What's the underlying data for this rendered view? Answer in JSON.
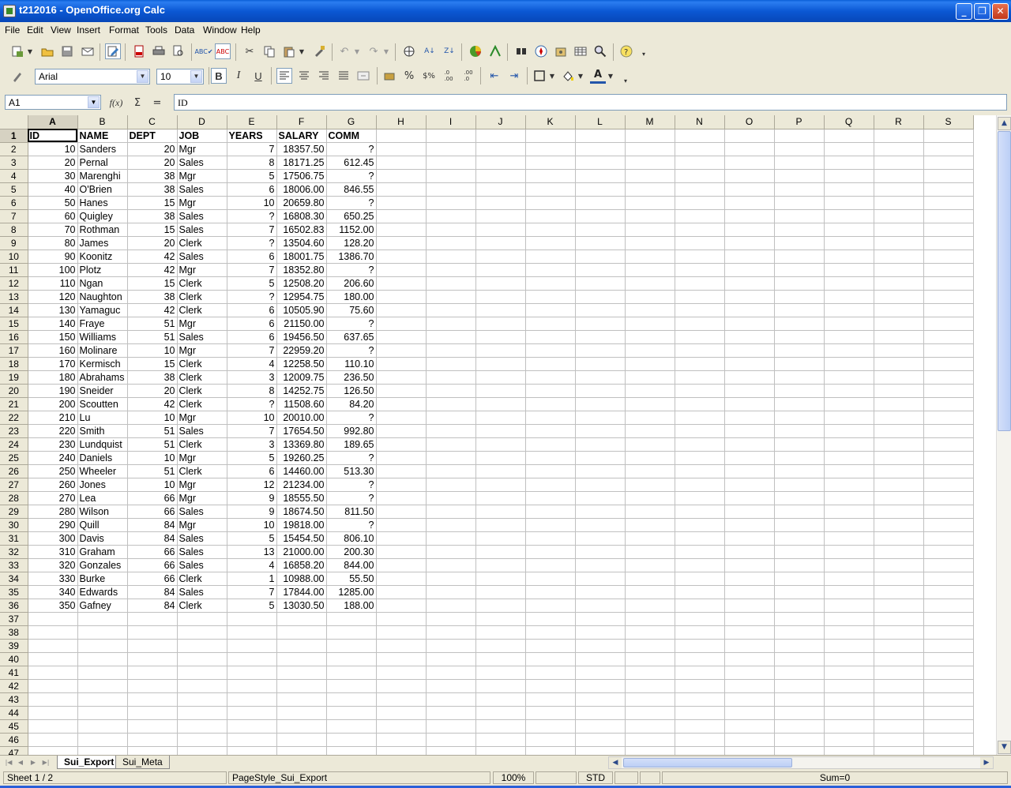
{
  "window": {
    "title": "t212016 - OpenOffice.org Calc"
  },
  "menu": [
    "File",
    "Edit",
    "View",
    "Insert",
    "Format",
    "Tools",
    "Data",
    "Window",
    "Help"
  ],
  "format_toolbar": {
    "font_name": "Arial",
    "font_size": "10"
  },
  "formula_bar": {
    "cell_ref": "A1",
    "content": "ID",
    "function_wizard": "f(x)",
    "sum": "Σ",
    "equals": "="
  },
  "columns": [
    "A",
    "B",
    "C",
    "D",
    "E",
    "F",
    "G",
    "H",
    "I",
    "J",
    "K",
    "L",
    "M",
    "N",
    "O",
    "P",
    "Q",
    "R",
    "S"
  ],
  "headers": [
    "ID",
    "NAME",
    "DEPT",
    "JOB",
    "YEARS",
    "SALARY",
    "COMM"
  ],
  "rows": [
    [
      "10",
      "Sanders",
      "20",
      "Mgr",
      "7",
      "18357.50",
      "?"
    ],
    [
      "20",
      "Pernal",
      "20",
      "Sales",
      "8",
      "18171.25",
      "612.45"
    ],
    [
      "30",
      "Marenghi",
      "38",
      "Mgr",
      "5",
      "17506.75",
      "?"
    ],
    [
      "40",
      "O'Brien",
      "38",
      "Sales",
      "6",
      "18006.00",
      "846.55"
    ],
    [
      "50",
      "Hanes",
      "15",
      "Mgr",
      "10",
      "20659.80",
      "?"
    ],
    [
      "60",
      "Quigley",
      "38",
      "Sales",
      "?",
      "16808.30",
      "650.25"
    ],
    [
      "70",
      "Rothman",
      "15",
      "Sales",
      "7",
      "16502.83",
      "1152.00"
    ],
    [
      "80",
      "James",
      "20",
      "Clerk",
      "?",
      "13504.60",
      "128.20"
    ],
    [
      "90",
      "Koonitz",
      "42",
      "Sales",
      "6",
      "18001.75",
      "1386.70"
    ],
    [
      "100",
      "Plotz",
      "42",
      "Mgr",
      "7",
      "18352.80",
      "?"
    ],
    [
      "110",
      "Ngan",
      "15",
      "Clerk",
      "5",
      "12508.20",
      "206.60"
    ],
    [
      "120",
      "Naughton",
      "38",
      "Clerk",
      "?",
      "12954.75",
      "180.00"
    ],
    [
      "130",
      "Yamaguc",
      "42",
      "Clerk",
      "6",
      "10505.90",
      "75.60"
    ],
    [
      "140",
      "Fraye",
      "51",
      "Mgr",
      "6",
      "21150.00",
      "?"
    ],
    [
      "150",
      "Williams",
      "51",
      "Sales",
      "6",
      "19456.50",
      "637.65"
    ],
    [
      "160",
      "Molinare",
      "10",
      "Mgr",
      "7",
      "22959.20",
      "?"
    ],
    [
      "170",
      "Kermisch",
      "15",
      "Clerk",
      "4",
      "12258.50",
      "110.10"
    ],
    [
      "180",
      "Abrahams",
      "38",
      "Clerk",
      "3",
      "12009.75",
      "236.50"
    ],
    [
      "190",
      "Sneider",
      "20",
      "Clerk",
      "8",
      "14252.75",
      "126.50"
    ],
    [
      "200",
      "Scoutten",
      "42",
      "Clerk",
      "?",
      "11508.60",
      "84.20"
    ],
    [
      "210",
      "Lu",
      "10",
      "Mgr",
      "10",
      "20010.00",
      "?"
    ],
    [
      "220",
      "Smith",
      "51",
      "Sales",
      "7",
      "17654.50",
      "992.80"
    ],
    [
      "230",
      "Lundquist",
      "51",
      "Clerk",
      "3",
      "13369.80",
      "189.65"
    ],
    [
      "240",
      "Daniels",
      "10",
      "Mgr",
      "5",
      "19260.25",
      "?"
    ],
    [
      "250",
      "Wheeler",
      "51",
      "Clerk",
      "6",
      "14460.00",
      "513.30"
    ],
    [
      "260",
      "Jones",
      "10",
      "Mgr",
      "12",
      "21234.00",
      "?"
    ],
    [
      "270",
      "Lea",
      "66",
      "Mgr",
      "9",
      "18555.50",
      "?"
    ],
    [
      "280",
      "Wilson",
      "66",
      "Sales",
      "9",
      "18674.50",
      "811.50"
    ],
    [
      "290",
      "Quill",
      "84",
      "Mgr",
      "10",
      "19818.00",
      "?"
    ],
    [
      "300",
      "Davis",
      "84",
      "Sales",
      "5",
      "15454.50",
      "806.10"
    ],
    [
      "310",
      "Graham",
      "66",
      "Sales",
      "13",
      "21000.00",
      "200.30"
    ],
    [
      "320",
      "Gonzales",
      "66",
      "Sales",
      "4",
      "16858.20",
      "844.00"
    ],
    [
      "330",
      "Burke",
      "66",
      "Clerk",
      "1",
      "10988.00",
      "55.50"
    ],
    [
      "340",
      "Edwards",
      "84",
      "Sales",
      "7",
      "17844.00",
      "1285.00"
    ],
    [
      "350",
      "Gafney",
      "84",
      "Clerk",
      "5",
      "13030.50",
      "188.00"
    ]
  ],
  "total_visible_rows": 47,
  "sheet_tabs": [
    "Sui_Export",
    "Sui_Meta"
  ],
  "active_tab": "Sui_Export",
  "status": {
    "sheet": "Sheet 1 / 2",
    "page_style": "PageStyle_Sui_Export",
    "zoom": "100%",
    "mode": "STD",
    "sum": "Sum=0"
  }
}
